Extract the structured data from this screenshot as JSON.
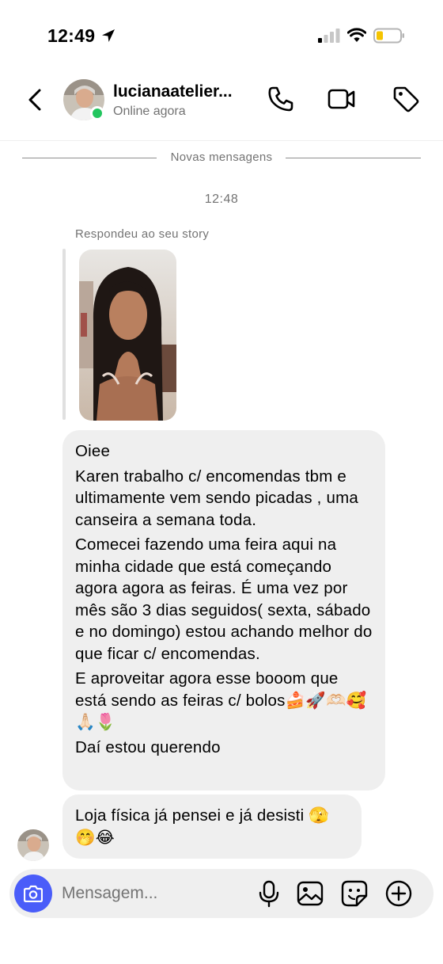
{
  "status_bar": {
    "time": "12:49"
  },
  "header": {
    "contact_name": "lucianaatelier...",
    "contact_status": "Online agora"
  },
  "thread": {
    "new_messages_divider": "Novas mensagens",
    "timestamp": "12:48",
    "story_reply_label": "Respondeu ao seu story",
    "message_1": {
      "paragraphs": [
        "Oiee",
        "Karen trabalho c/ encomendas tbm e ultimamente vem sendo picadas , uma canseira a semana toda.",
        "Comecei fazendo uma feira aqui na minha cidade que está começando agora agora as feiras. É uma vez por mês são 3 dias seguidos( sexta, sábado e no domingo) estou achando melhor do que ficar c/ encomendas.",
        "E aproveitar agora esse booom que está sendo as feiras c/ bolos🍰🚀🫶🏻🥰🙏🏻🌷",
        "Daí estou querendo"
      ]
    },
    "message_2": {
      "text": "Loja física já pensei e já desisti 🫣🤭😂"
    }
  },
  "composer": {
    "placeholder": "Mensagem..."
  },
  "icons": {
    "back": "chevron-left-icon",
    "call": "phone-icon",
    "video": "video-camera-icon",
    "tag": "tag-icon",
    "camera": "camera-icon",
    "mic": "microphone-icon",
    "gallery": "image-icon",
    "sticker": "sticker-icon",
    "add": "plus-circle-icon"
  },
  "colors": {
    "online": "#22c55e",
    "camera_button": "#4a5df9",
    "bubble": "#efefef",
    "secondary_text": "#737373"
  }
}
